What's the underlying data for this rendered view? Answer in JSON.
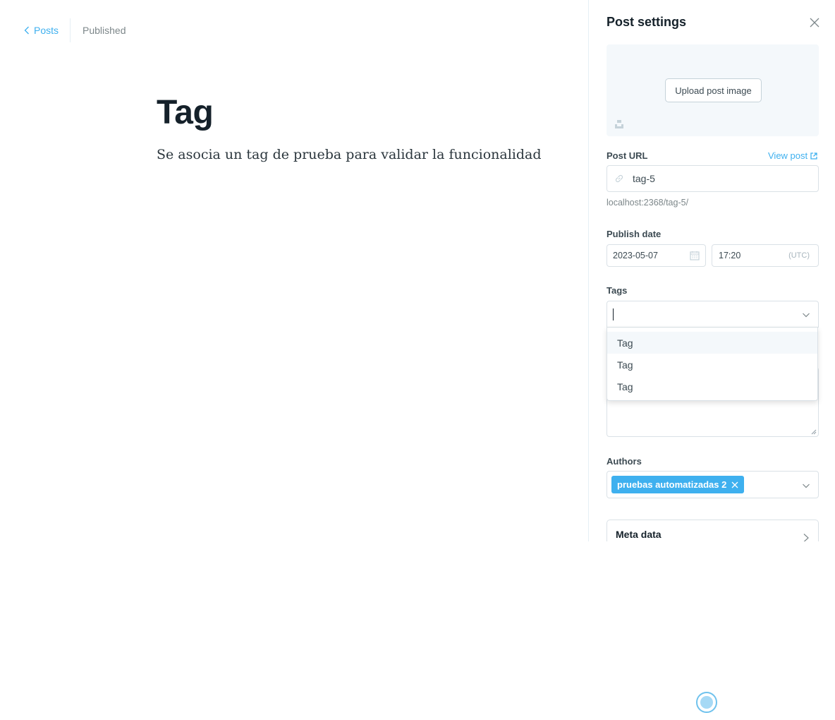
{
  "breadcrumb": {
    "back_label": "Posts",
    "status": "Published"
  },
  "post": {
    "title": "Tag",
    "body": "Se asocia un tag de prueba para validar la funcionalidad"
  },
  "settings": {
    "title": "Post settings",
    "upload_label": "Upload post image",
    "post_url_label": "Post URL",
    "view_post_label": "View post",
    "slug": "tag-5",
    "url_hint": "localhost:2368/tag-5/",
    "publish_date_label": "Publish date",
    "date": "2023-05-07",
    "time": "17:20",
    "timezone": "(UTC)",
    "tags_label": "Tags",
    "tag_options": [
      "Tag",
      "Tag",
      "Tag"
    ],
    "authors_label": "Authors",
    "author": "pruebas automatizadas 2",
    "meta_label": "Meta data"
  },
  "colors": {
    "accent": "#3eb0ef",
    "text": "#15212a",
    "muted": "#7d878a",
    "border": "#dae1e6"
  },
  "icons": [
    "chevron-left-icon",
    "close-icon",
    "unsplash-icon",
    "external-link-icon",
    "link-icon",
    "calendar-icon",
    "chevron-down-icon",
    "chevron-right-icon"
  ]
}
